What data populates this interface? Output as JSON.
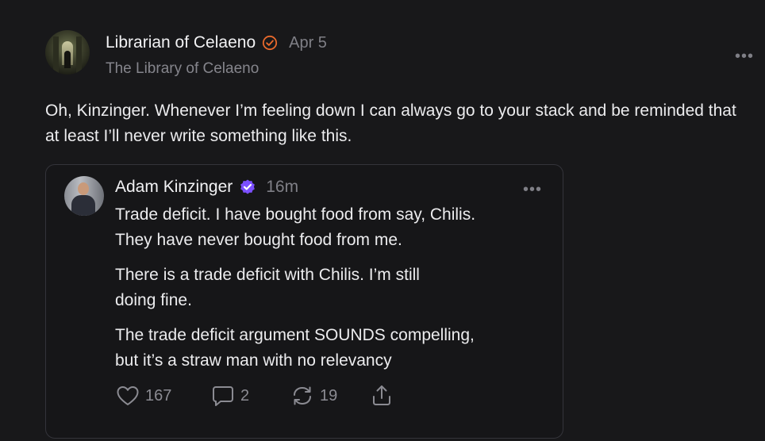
{
  "post": {
    "author": "Librarian of Celaeno",
    "date": "Apr 5",
    "publication": "The Library of Celaeno",
    "body": "Oh, Kinzinger. Whenever I’m feeling down I can always go to your stack and be reminded that at least I’ll never write something like this.",
    "more": "•••",
    "verified_color": "#e8692c"
  },
  "quote": {
    "author": "Adam Kinzinger",
    "time": "16m",
    "more": "•••",
    "verified_color": "#7b4fff",
    "paragraphs": [
      {
        "line1": "Trade deficit.  I have bought food from say, Chilis.",
        "line2": "They have never bought food from me."
      },
      {
        "line1": "There is a trade deficit with Chilis.  I’m still",
        "line2": "doing fine."
      },
      {
        "line1": "The trade deficit argument SOUNDS compelling,",
        "line2": "but it’s a straw man with no relevancy"
      }
    ],
    "actions": {
      "likes": "167",
      "comments": "2",
      "restacks": "19"
    }
  },
  "icons": {
    "like": "heart-icon",
    "comment": "comment-bubble-icon",
    "restack": "restack-icon",
    "share": "share-icon"
  }
}
